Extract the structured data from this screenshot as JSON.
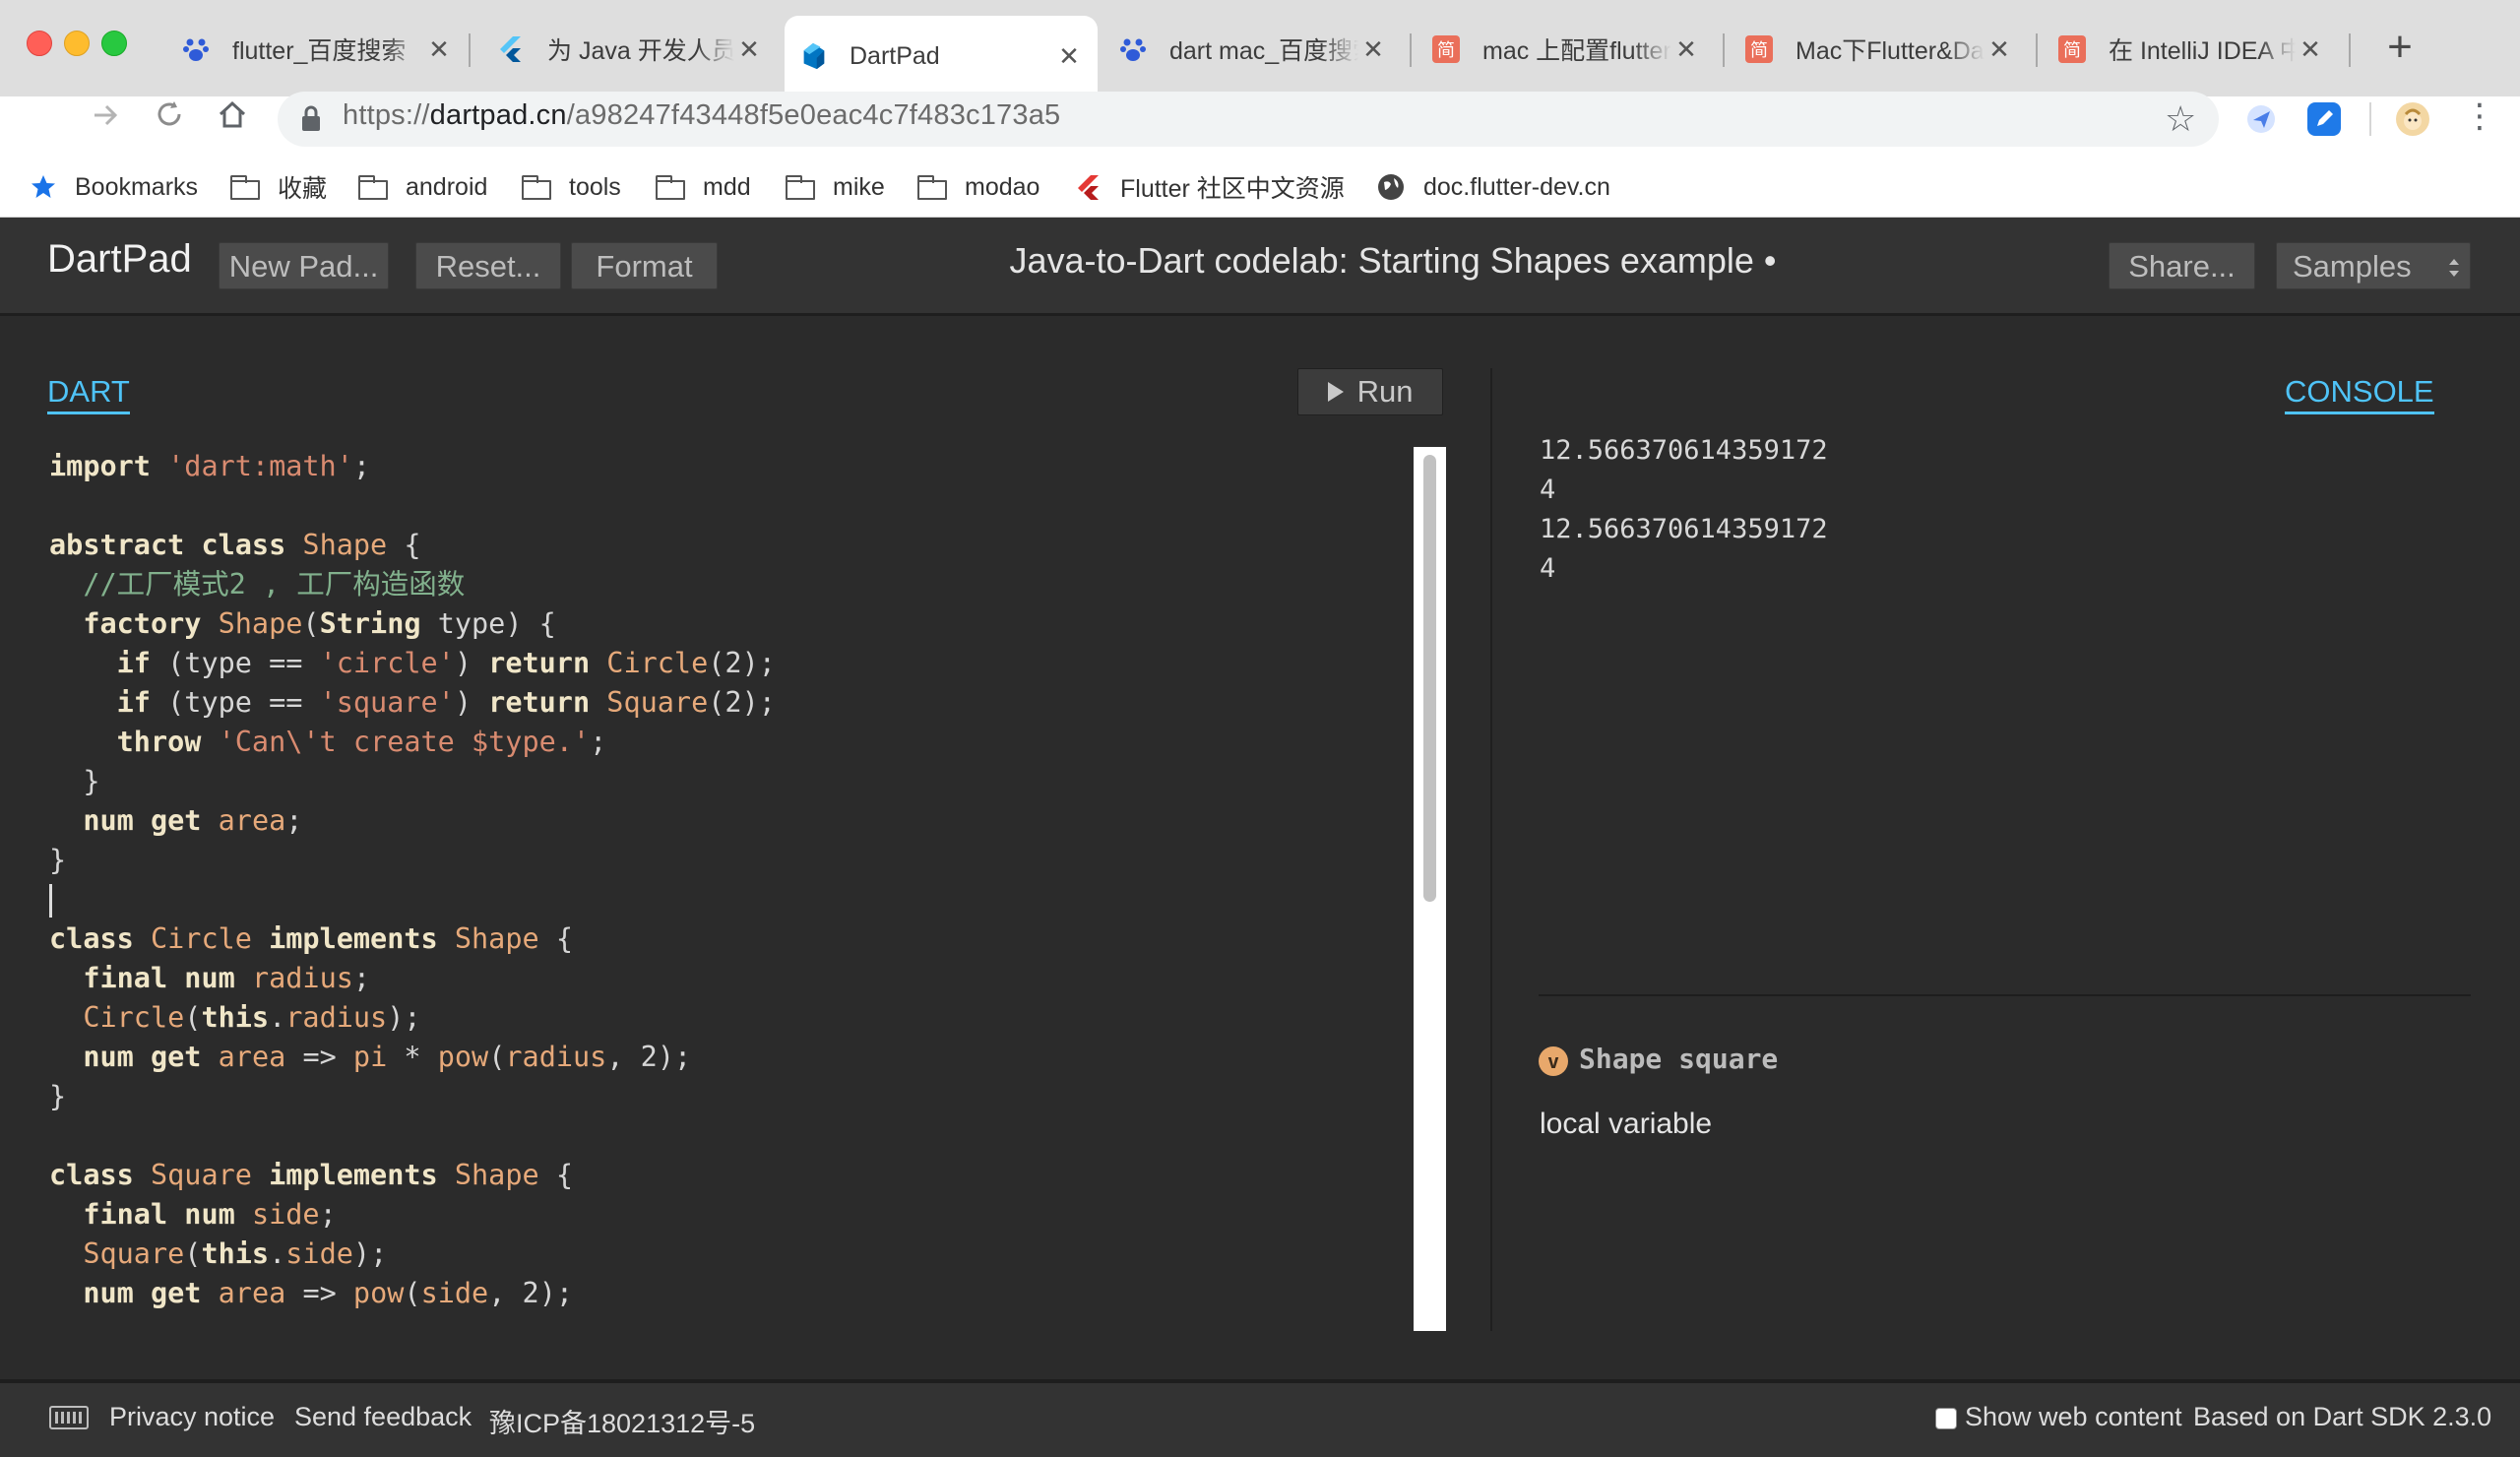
{
  "browser": {
    "tabs": [
      {
        "title": "flutter_百度搜索",
        "icon": "baidu-paw-icon"
      },
      {
        "title": "为 Java 开发人员准备的 Dart 指南",
        "icon": "flutter-icon"
      },
      {
        "title": "DartPad",
        "icon": "dart-icon",
        "active": true
      },
      {
        "title": "dart mac_百度搜索",
        "icon": "baidu-paw-icon"
      },
      {
        "title": "mac 上配置flutter",
        "icon": "jianshu-icon"
      },
      {
        "title": "Mac下Flutter&Dart",
        "icon": "jianshu-icon"
      },
      {
        "title": "在 IntelliJ IDEA 中",
        "icon": "jianshu-icon"
      }
    ],
    "url_scheme": "https://",
    "url_host": "dartpad.cn",
    "url_path": "/a98247f43448f5e0eac4c7f483c173a5",
    "bookmarks": [
      {
        "label": "Bookmarks",
        "icon": "star-icon"
      },
      {
        "label": "收藏",
        "icon": "folder-icon"
      },
      {
        "label": "android",
        "icon": "folder-icon"
      },
      {
        "label": "tools",
        "icon": "folder-icon"
      },
      {
        "label": "mdd",
        "icon": "folder-icon"
      },
      {
        "label": "mike",
        "icon": "folder-icon"
      },
      {
        "label": "modao",
        "icon": "folder-icon"
      },
      {
        "label": "Flutter 社区中文资源",
        "icon": "flutter-icon"
      },
      {
        "label": "doc.flutter-dev.cn",
        "icon": "globe-icon"
      }
    ]
  },
  "dartpad": {
    "logo": "DartPad",
    "new_pad": "New Pad...",
    "reset": "Reset...",
    "format": "Format",
    "title": "Java-to-Dart codelab: Starting Shapes example •",
    "share": "Share...",
    "samples": "Samples",
    "editor_tab": "DART",
    "run": "Run",
    "console_tab": "CONSOLE",
    "console_lines": [
      "12.566370614359172",
      "4",
      "12.566370614359172",
      "4"
    ],
    "doc_badge": "v",
    "doc_name": "Shape square",
    "doc_kind": "local variable"
  },
  "footer": {
    "privacy": "Privacy notice",
    "feedback": "Send feedback",
    "icp": "豫ICP备18021312号-5",
    "show_web": "Show web content",
    "sdk": "Based on Dart SDK 2.3.0"
  },
  "code_lines": [
    [
      [
        "kw",
        "import"
      ],
      [
        "p",
        " "
      ],
      [
        "str",
        "'dart:math'"
      ],
      [
        "p",
        ";"
      ]
    ],
    [],
    [
      [
        "kw",
        "abstract"
      ],
      [
        "p",
        " "
      ],
      [
        "kw",
        "class"
      ],
      [
        "p",
        " "
      ],
      [
        "ty",
        "Shape"
      ],
      [
        "p",
        " {"
      ]
    ],
    [
      [
        "p",
        "  "
      ],
      [
        "cm",
        "//工厂模式2 , 工厂构造函数"
      ]
    ],
    [
      [
        "p",
        "  "
      ],
      [
        "kw",
        "factory"
      ],
      [
        "p",
        " "
      ],
      [
        "ty",
        "Shape"
      ],
      [
        "p",
        "("
      ],
      [
        "kw",
        "String"
      ],
      [
        "p",
        " type) {"
      ]
    ],
    [
      [
        "p",
        "    "
      ],
      [
        "kw",
        "if"
      ],
      [
        "p",
        " (type == "
      ],
      [
        "str",
        "'circle'"
      ],
      [
        "p",
        ") "
      ],
      [
        "kw",
        "return"
      ],
      [
        "p",
        " "
      ],
      [
        "ty",
        "Circle"
      ],
      [
        "p",
        "(2);"
      ]
    ],
    [
      [
        "p",
        "    "
      ],
      [
        "kw",
        "if"
      ],
      [
        "p",
        " (type == "
      ],
      [
        "str",
        "'square'"
      ],
      [
        "p",
        ") "
      ],
      [
        "kw",
        "return"
      ],
      [
        "p",
        " "
      ],
      [
        "ty",
        "Square"
      ],
      [
        "p",
        "(2);"
      ]
    ],
    [
      [
        "p",
        "    "
      ],
      [
        "kw",
        "throw"
      ],
      [
        "p",
        " "
      ],
      [
        "str",
        "'Can\\'t create $type.'"
      ],
      [
        "p",
        ";"
      ]
    ],
    [
      [
        "p",
        "  }"
      ]
    ],
    [
      [
        "p",
        "  "
      ],
      [
        "kw",
        "num"
      ],
      [
        "p",
        " "
      ],
      [
        "kw",
        "get"
      ],
      [
        "p",
        " "
      ],
      [
        "ty",
        "area"
      ],
      [
        "p",
        ";"
      ]
    ],
    [
      [
        "p",
        "}"
      ]
    ],
    [
      [
        "caret",
        ""
      ]
    ],
    [
      [
        "kw",
        "class"
      ],
      [
        "p",
        " "
      ],
      [
        "ty",
        "Circle"
      ],
      [
        "p",
        " "
      ],
      [
        "kw",
        "implements"
      ],
      [
        "p",
        " "
      ],
      [
        "ty",
        "Shape"
      ],
      [
        "p",
        " {"
      ]
    ],
    [
      [
        "p",
        "  "
      ],
      [
        "kw",
        "final"
      ],
      [
        "p",
        " "
      ],
      [
        "kw",
        "num"
      ],
      [
        "p",
        " "
      ],
      [
        "ty",
        "radius"
      ],
      [
        "p",
        ";"
      ]
    ],
    [
      [
        "p",
        "  "
      ],
      [
        "ty",
        "Circle"
      ],
      [
        "p",
        "("
      ],
      [
        "kw",
        "this"
      ],
      [
        "p",
        "."
      ],
      [
        "ty",
        "radius"
      ],
      [
        "p",
        ");"
      ]
    ],
    [
      [
        "p",
        "  "
      ],
      [
        "kw",
        "num"
      ],
      [
        "p",
        " "
      ],
      [
        "kw",
        "get"
      ],
      [
        "p",
        " "
      ],
      [
        "ty",
        "area"
      ],
      [
        "p",
        " => "
      ],
      [
        "ty",
        "pi"
      ],
      [
        "p",
        " * "
      ],
      [
        "ty",
        "pow"
      ],
      [
        "p",
        "("
      ],
      [
        "ty",
        "radius"
      ],
      [
        "p",
        ", 2);"
      ]
    ],
    [
      [
        "p",
        "}"
      ]
    ],
    [],
    [
      [
        "kw",
        "class"
      ],
      [
        "p",
        " "
      ],
      [
        "ty",
        "Square"
      ],
      [
        "p",
        " "
      ],
      [
        "kw",
        "implements"
      ],
      [
        "p",
        " "
      ],
      [
        "ty",
        "Shape"
      ],
      [
        "p",
        " {"
      ]
    ],
    [
      [
        "p",
        "  "
      ],
      [
        "kw",
        "final"
      ],
      [
        "p",
        " "
      ],
      [
        "kw",
        "num"
      ],
      [
        "p",
        " "
      ],
      [
        "ty",
        "side"
      ],
      [
        "p",
        ";"
      ]
    ],
    [
      [
        "p",
        "  "
      ],
      [
        "ty",
        "Square"
      ],
      [
        "p",
        "("
      ],
      [
        "kw",
        "this"
      ],
      [
        "p",
        "."
      ],
      [
        "ty",
        "side"
      ],
      [
        "p",
        ");"
      ]
    ],
    [
      [
        "p",
        "  "
      ],
      [
        "kw",
        "num"
      ],
      [
        "p",
        " "
      ],
      [
        "kw",
        "get"
      ],
      [
        "p",
        " "
      ],
      [
        "ty",
        "area"
      ],
      [
        "p",
        " => "
      ],
      [
        "ty",
        "pow"
      ],
      [
        "p",
        "("
      ],
      [
        "ty",
        "side"
      ],
      [
        "p",
        ", 2);"
      ]
    ]
  ],
  "colors": {
    "accent": "#4fc3f7",
    "editor_bg": "#2b2b2b",
    "header_bg": "#333333",
    "keyword": "#f0e6c8",
    "identifier": "#e6a97a",
    "string": "#d98b70",
    "comment": "#82b18d"
  }
}
